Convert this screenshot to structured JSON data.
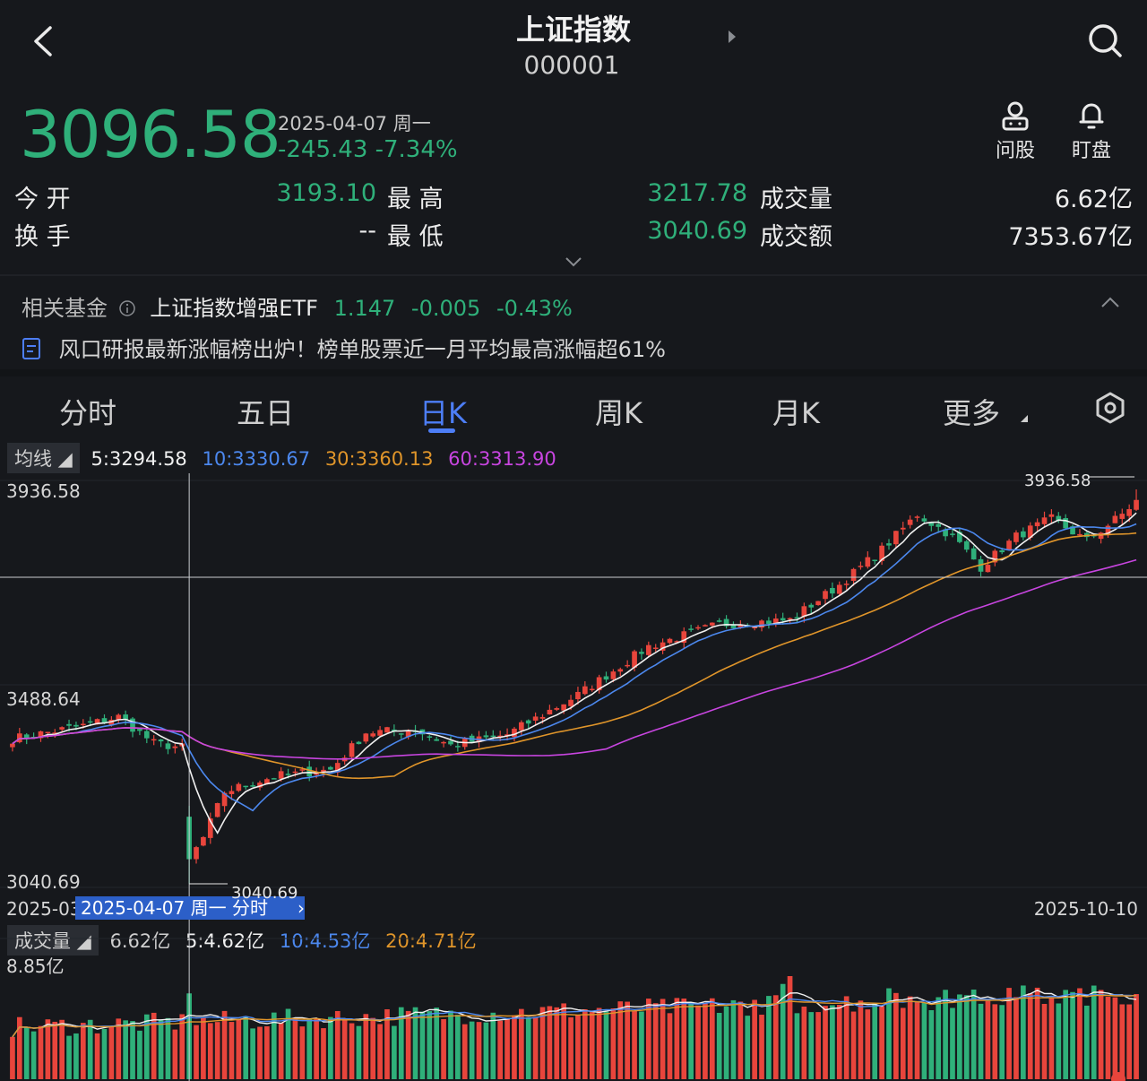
{
  "header": {
    "title": "上证指数",
    "code": "000001",
    "back_icon": "chevron-left-icon",
    "search_icon": "search-icon",
    "actions": [
      {
        "label": "问股",
        "icon": "user-icon"
      },
      {
        "label": "盯盘",
        "icon": "bell-icon"
      }
    ]
  },
  "quote": {
    "price": "3096.58",
    "date": "2025-04-07 周一",
    "change": "-245.43 -7.34%"
  },
  "stats": [
    {
      "label": "今 开",
      "value": "3193.10"
    },
    {
      "label": "最 高",
      "value": "3217.78"
    },
    {
      "label": "成交量",
      "value": "6.62亿"
    },
    {
      "label": "换 手",
      "value": "--"
    },
    {
      "label": "最 低",
      "value": "3040.69"
    },
    {
      "label": "成交额",
      "value": "7353.67亿"
    }
  ],
  "fund": {
    "label": "相关基金",
    "name": "上证指数增强ETF",
    "price": "1.147",
    "change": "-0.005",
    "pct": "-0.43%"
  },
  "news": {
    "text": "风口研报最新涨幅榜出炉！榜单股票近一月平均最高涨幅超61%"
  },
  "tabs": [
    "分时",
    "五日",
    "日K",
    "周K",
    "月K",
    "更多"
  ],
  "active_tab": "日K",
  "ma": {
    "label": "均线",
    "ma5": "5:3294.58",
    "ma10": "10:3330.67",
    "ma30": "30:3360.13",
    "ma60": "60:3313.90"
  },
  "volume_row": {
    "label": "成交量",
    "vol": "6.62亿",
    "ma5": "5:4.62亿",
    "ma10": "10:4.53亿",
    "ma20": "20:4.71亿"
  },
  "colors": {
    "up": "#e8453c",
    "down": "#2fb07a",
    "ma5": "#f0f0f0",
    "ma10": "#4c88ee",
    "ma30": "#e0952a",
    "ma60": "#c845e0"
  },
  "chart_data": {
    "type": "candlestick",
    "y_axis_labels": [
      "3936.58",
      "3488.64",
      "3040.69"
    ],
    "ylim": [
      3040.69,
      3936.58
    ],
    "x_start_label": "2025-03",
    "x_end_label": "2025-10-10",
    "crosshair_label": "2025-04-07 周一 分时",
    "low_marker": "3040.69",
    "high_marker": "3936.58",
    "volume_axis_label": "8.85亿",
    "volume_max": 8.85,
    "close_anchors": [
      {
        "i": 0,
        "v": 3370
      },
      {
        "i": 10,
        "v": 3400
      },
      {
        "i": 15,
        "v": 3420
      },
      {
        "i": 20,
        "v": 3360
      },
      {
        "i": 24,
        "v": 3350
      },
      {
        "i": 25,
        "v": 3096.58
      },
      {
        "i": 27,
        "v": 3145
      },
      {
        "i": 30,
        "v": 3250
      },
      {
        "i": 37,
        "v": 3285
      },
      {
        "i": 45,
        "v": 3300
      },
      {
        "i": 50,
        "v": 3385
      },
      {
        "i": 57,
        "v": 3390
      },
      {
        "i": 62,
        "v": 3355
      },
      {
        "i": 70,
        "v": 3380
      },
      {
        "i": 80,
        "v": 3470
      },
      {
        "i": 90,
        "v": 3580
      },
      {
        "i": 100,
        "v": 3630
      },
      {
        "i": 110,
        "v": 3640
      },
      {
        "i": 117,
        "v": 3720
      },
      {
        "i": 123,
        "v": 3800
      },
      {
        "i": 128,
        "v": 3880
      },
      {
        "i": 133,
        "v": 3830
      },
      {
        "i": 137,
        "v": 3760
      },
      {
        "i": 142,
        "v": 3830
      },
      {
        "i": 147,
        "v": 3870
      },
      {
        "i": 152,
        "v": 3820
      },
      {
        "i": 157,
        "v": 3880
      },
      {
        "i": 159,
        "v": 3910
      }
    ]
  }
}
